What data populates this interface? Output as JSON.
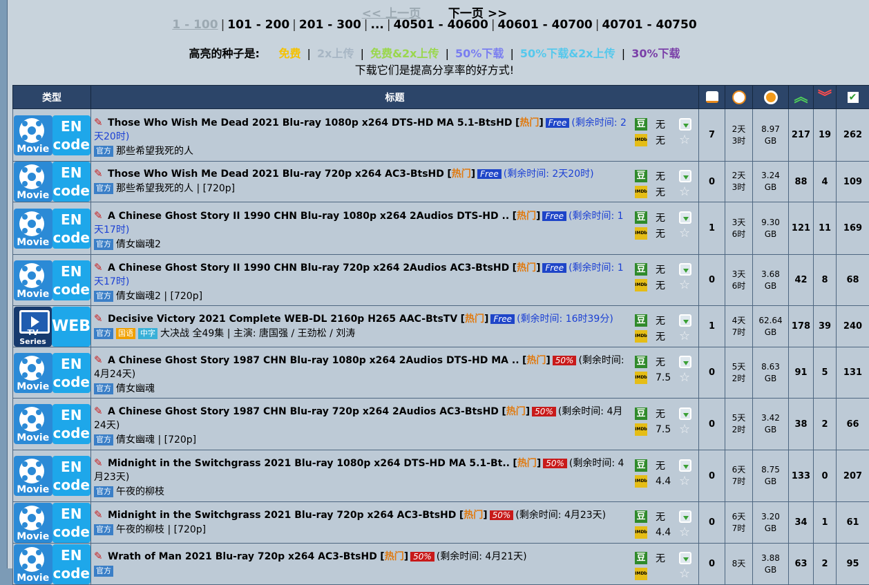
{
  "pager": {
    "prev": "<< 上一页",
    "next": "下一页 >>",
    "current": "1 - 100",
    "pages": [
      "101 - 200",
      "201 - 300",
      "...",
      "40501 - 40600",
      "40601 - 40700",
      "40701 - 40750"
    ]
  },
  "legend": {
    "label": "高亮的种子是:",
    "free": "免费",
    "x2": "2x上传",
    "free2x": "免费&2x上传",
    "half": "50%下载",
    "half2x": "50%下载&2x上传",
    "thirty": "30%下载",
    "tip": "下载它们是提高分享率的好方式!"
  },
  "columns": {
    "type": "类型",
    "title": "标题",
    "icons": [
      "comments-icon",
      "time-icon",
      "size-icon",
      "seeders-icon",
      "leechers-icon",
      "completed-icon"
    ]
  },
  "rows": [
    {
      "cat": "movie",
      "cat_left": "Movie",
      "cat_right": "EN code",
      "title": "Those Who Wish Me Dead 2021 Blu-ray 1080p x264 DTS-HD MA 5.1-BtsHD",
      "hot": "热门",
      "promo": "Free",
      "remain": "(剩余时间: 2天20时)",
      "badges": [
        "官方"
      ],
      "subtitle": "那些希望我死的人",
      "douban": "无",
      "imdb": "无",
      "comments": "7",
      "age": "2天\n3时",
      "size": "8.97\nGB",
      "seeders": "217",
      "leechers": "19",
      "completed": "262"
    },
    {
      "cat": "movie",
      "cat_left": "Movie",
      "cat_right": "EN code",
      "title": "Those Who Wish Me Dead 2021 Blu-ray 720p x264 AC3-BtsHD",
      "hot": "热门",
      "promo": "Free",
      "remain": "(剩余时间: 2天20时)",
      "badges": [
        "官方"
      ],
      "subtitle": "那些希望我死的人 | [720p]",
      "douban": "无",
      "imdb": "无",
      "comments": "0",
      "age": "2天\n3时",
      "size": "3.24\nGB",
      "seeders": "88",
      "leechers": "4",
      "completed": "109"
    },
    {
      "cat": "movie",
      "cat_left": "Movie",
      "cat_right": "EN code",
      "title": "A Chinese Ghost Story II 1990 CHN Blu-ray 1080p x264 2Audios DTS-HD ..",
      "hot": "热门",
      "promo": "Free",
      "remain": "(剩余时间: 1天17时)",
      "badges": [
        "官方"
      ],
      "subtitle": "倩女幽魂2",
      "douban": "无",
      "imdb": "无",
      "comments": "1",
      "age": "3天\n6时",
      "size": "9.30\nGB",
      "seeders": "121",
      "leechers": "11",
      "completed": "169"
    },
    {
      "cat": "movie",
      "cat_left": "Movie",
      "cat_right": "EN code",
      "title": "A Chinese Ghost Story II 1990 CHN Blu-ray 720p x264 2Audios AC3-BtsHD",
      "hot": "热门",
      "promo": "Free",
      "remain": "(剩余时间: 1天17时)",
      "badges": [
        "官方"
      ],
      "subtitle": "倩女幽魂2 | [720p]",
      "douban": "无",
      "imdb": "无",
      "comments": "0",
      "age": "3天\n6时",
      "size": "3.68\nGB",
      "seeders": "42",
      "leechers": "8",
      "completed": "68"
    },
    {
      "cat": "tv",
      "cat_left": "TV Series",
      "cat_right": "WEB",
      "title": "Decisive Victory 2021 Complete WEB-DL 2160p H265 AAC-BtsTV",
      "hot": "热门",
      "promo": "Free",
      "remain": "(剩余时间: 16时39分)",
      "badges": [
        "官方",
        "国语",
        "中字"
      ],
      "subtitle": "大决战 全49集 | 主演: 唐国强 / 王劲松 / 刘涛",
      "douban": "无",
      "imdb": "无",
      "comments": "1",
      "age": "4天\n7时",
      "size": "62.64\nGB",
      "seeders": "178",
      "leechers": "39",
      "completed": "240"
    },
    {
      "cat": "movie",
      "cat_left": "Movie",
      "cat_right": "EN code",
      "title": "A Chinese Ghost Story 1987 CHN Blu-ray 1080p x264 2Audios DTS-HD MA ..",
      "hot": "热门",
      "promo": "50%",
      "remain": "(剩余时间: 4月24天)",
      "badges": [
        "官方"
      ],
      "subtitle": "倩女幽魂",
      "douban": "无",
      "imdb": "7.5",
      "comments": "0",
      "age": "5天\n2时",
      "size": "8.63\nGB",
      "seeders": "91",
      "leechers": "5",
      "completed": "131"
    },
    {
      "cat": "movie",
      "cat_left": "Movie",
      "cat_right": "EN code",
      "title": "A Chinese Ghost Story 1987 CHN Blu-ray 720p x264 2Audios AC3-BtsHD",
      "hot": "热门",
      "promo": "50%",
      "remain": "(剩余时间: 4月24天)",
      "badges": [
        "官方"
      ],
      "subtitle": "倩女幽魂 | [720p]",
      "douban": "无",
      "imdb": "7.5",
      "comments": "0",
      "age": "5天\n2时",
      "size": "3.42\nGB",
      "seeders": "38",
      "leechers": "2",
      "completed": "66"
    },
    {
      "cat": "movie",
      "cat_left": "Movie",
      "cat_right": "EN code",
      "title": "Midnight in the Switchgrass 2021 Blu-ray 1080p x264 DTS-HD MA 5.1-Bt..",
      "hot": "热门",
      "promo": "50%",
      "remain": "(剩余时间: 4月23天)",
      "badges": [
        "官方"
      ],
      "subtitle": "午夜的柳枝",
      "douban": "无",
      "imdb": "4.4",
      "comments": "0",
      "age": "6天\n7时",
      "size": "8.75\nGB",
      "seeders": "133",
      "leechers": "0",
      "completed": "207"
    },
    {
      "cat": "movie",
      "cat_left": "Movie",
      "cat_right": "EN code",
      "title": "Midnight in the Switchgrass 2021 Blu-ray 720p x264 AC3-BtsHD",
      "hot": "热门",
      "promo": "50%",
      "remain": "(剩余时间: 4月23天)",
      "badges": [
        "官方"
      ],
      "subtitle": "午夜的柳枝 | [720p]",
      "douban": "无",
      "imdb": "4.4",
      "comments": "0",
      "age": "6天\n7时",
      "size": "3.20\nGB",
      "seeders": "34",
      "leechers": "1",
      "completed": "61"
    },
    {
      "cat": "movie",
      "cat_left": "Movie",
      "cat_right": "EN code",
      "title": "Wrath of Man 2021 Blu-ray 720p x264 AC3-BtsHD",
      "hot": "热门",
      "promo": "50%",
      "remain": "(剩余时间: 4月21天)",
      "badges": [
        "官方"
      ],
      "subtitle": "",
      "douban": "无",
      "imdb": "",
      "comments": "0",
      "age": "8天",
      "size": "3.88\nGB",
      "seeders": "63",
      "leechers": "2",
      "completed": "95"
    }
  ]
}
